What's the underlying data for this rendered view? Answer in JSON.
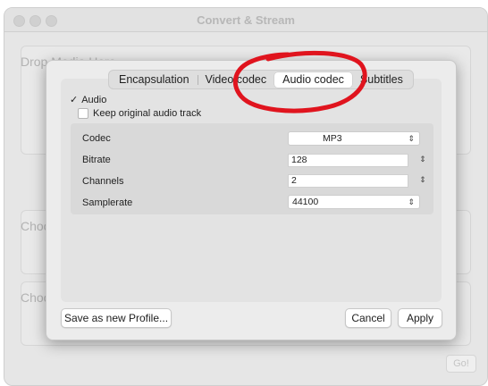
{
  "window": {
    "title": "Convert & Stream",
    "go_label": "Go!"
  },
  "background_groups": [
    {
      "label": "Drop Media Here"
    },
    {
      "label": "Choose Profile"
    },
    {
      "label": "Choose Destination"
    }
  ],
  "tabs": [
    {
      "label": "Encapsulation",
      "active": false
    },
    {
      "label": "Video codec",
      "active": false
    },
    {
      "label": "Audio codec",
      "active": true
    },
    {
      "label": "Subtitles",
      "active": false
    }
  ],
  "audio": {
    "enable_label": "Audio",
    "enable_checked": true,
    "keep_original_label": "Keep original audio track",
    "keep_original_checked": false
  },
  "settings": {
    "codec": {
      "label": "Codec",
      "value": "MP3"
    },
    "bitrate": {
      "label": "Bitrate",
      "value": "128"
    },
    "channels": {
      "label": "Channels",
      "value": "2"
    },
    "samplerate": {
      "label": "Samplerate",
      "value": "44100"
    }
  },
  "buttons": {
    "save_profile": "Save as new Profile...",
    "cancel": "Cancel",
    "apply": "Apply"
  },
  "icons": {
    "checkmark": "✓",
    "popup_arrows": "⌃⌄",
    "stepper_arrows": "⌃⌄"
  },
  "colors": {
    "annotation_red": "#e0141e"
  }
}
